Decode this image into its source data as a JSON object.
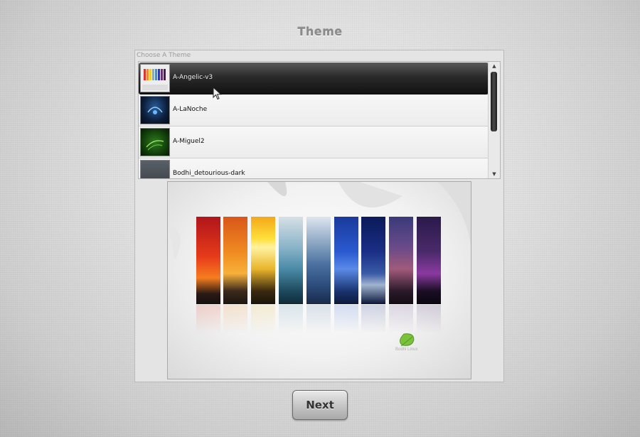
{
  "window": {
    "title": "Theme"
  },
  "theme_group": {
    "label": "Choose A Theme",
    "themes": [
      {
        "name": "A-Angelic-v3",
        "selected": true
      },
      {
        "name": "A-LaNoche",
        "selected": false
      },
      {
        "name": "A-Miguel2",
        "selected": false
      },
      {
        "name": "Bodhi_detourious-dark",
        "selected": false
      }
    ]
  },
  "preview": {
    "logo_text": "Bodhi Linux"
  },
  "footer": {
    "next_label": "Next"
  },
  "colors": {
    "selected_row": "#1a1a1a",
    "background": "#e2e2e2",
    "preview_bg": "#f5f5f5"
  }
}
